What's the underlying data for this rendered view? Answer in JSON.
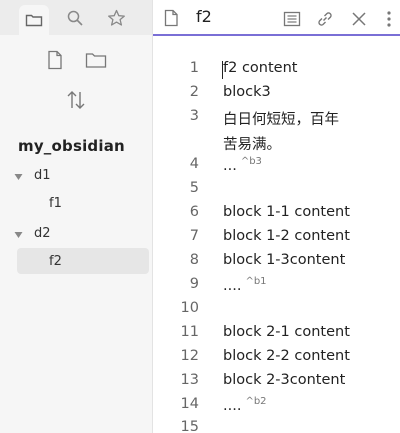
{
  "sidebar": {
    "tabs": [
      {
        "icon": "folder-icon",
        "active": true
      },
      {
        "icon": "search-icon",
        "active": false
      },
      {
        "icon": "star-icon",
        "active": false
      }
    ],
    "actions": [
      "new-note-icon",
      "new-folder-icon",
      "sort-icon"
    ],
    "vault_name": "my_obsidian",
    "tree": [
      {
        "label": "d1",
        "type": "folder",
        "expanded": true
      },
      {
        "label": "f1",
        "type": "file"
      },
      {
        "label": "d2",
        "type": "folder",
        "expanded": true
      },
      {
        "label": "f2",
        "type": "file",
        "selected": true
      }
    ]
  },
  "editor": {
    "title": "f2",
    "accent_color": "#7a6fd6",
    "lines": [
      {
        "num": "1",
        "text": "f2 content",
        "ref": ""
      },
      {
        "num": "2",
        "text": "block3",
        "ref": ""
      },
      {
        "num": "3",
        "text": "白日何短短，百年",
        "ref": ""
      },
      {
        "num": "",
        "text": "苦易满。",
        "ref": ""
      },
      {
        "num": "4",
        "text": "...",
        "ref": "^b3"
      },
      {
        "num": "5",
        "text": "",
        "ref": ""
      },
      {
        "num": "6",
        "text": "block 1-1 content",
        "ref": ""
      },
      {
        "num": "7",
        "text": "block 1-2 content",
        "ref": ""
      },
      {
        "num": "8",
        "text": "block 1-3content",
        "ref": ""
      },
      {
        "num": "9",
        "text": "....",
        "ref": "^b1"
      },
      {
        "num": "10",
        "text": "",
        "ref": ""
      },
      {
        "num": "11",
        "text": "block 2-1 content",
        "ref": ""
      },
      {
        "num": "12",
        "text": "block 2-2 content",
        "ref": ""
      },
      {
        "num": "13",
        "text": "block 2-3content",
        "ref": ""
      },
      {
        "num": "14",
        "text": "....",
        "ref": "^b2"
      },
      {
        "num": "15",
        "text": "",
        "ref": ""
      }
    ]
  }
}
